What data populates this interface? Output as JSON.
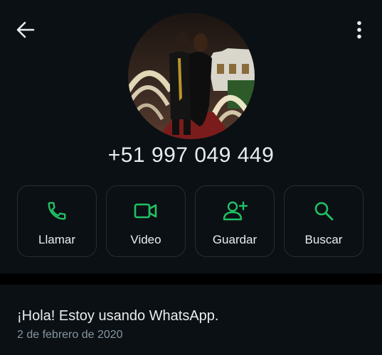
{
  "header": {
    "back_icon": "arrow-left-icon",
    "menu_icon": "more-vertical-icon"
  },
  "contact": {
    "phone": "+51 997 049 449",
    "avatar": "profile-photo"
  },
  "actions": [
    {
      "label": "Llamar",
      "icon": "phone-icon"
    },
    {
      "label": "Video",
      "icon": "video-icon"
    },
    {
      "label": "Guardar",
      "icon": "add-person-icon"
    },
    {
      "label": "Buscar",
      "icon": "search-icon"
    }
  ],
  "about": {
    "text": "¡Hola! Estoy usando WhatsApp.",
    "date": "2 de febrero de 2020"
  },
  "colors": {
    "background": "#0b1014",
    "accent": "#21c063",
    "text_primary": "#e9edef",
    "text_secondary": "#8696a0",
    "border": "#262d31"
  }
}
